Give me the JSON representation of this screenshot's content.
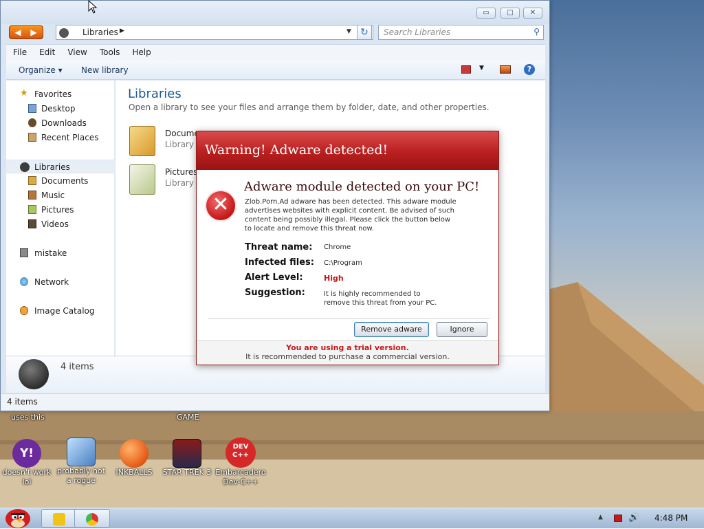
{
  "explorer": {
    "window_controls": {
      "minimize": "▭",
      "maximize": "□",
      "close": "✕"
    },
    "address": {
      "crumb": "Libraries"
    },
    "search": {
      "placeholder": "Search Libraries"
    },
    "menu": [
      "File",
      "Edit",
      "View",
      "Tools",
      "Help"
    ],
    "toolbar": {
      "organize": "Organize",
      "new_library": "New library"
    },
    "nav": {
      "favorites": "Favorites",
      "desktop": "Desktop",
      "downloads": "Downloads",
      "recent": "Recent Places",
      "libraries": "Libraries",
      "documents": "Documents",
      "music": "Music",
      "pictures": "Pictures",
      "videos": "Videos",
      "mistake": "mistake",
      "network": "Network",
      "image_catalog": "Image Catalog"
    },
    "content": {
      "heading": "Libraries",
      "description": "Open a library to see your files and arrange them by folder, date, and other properties.",
      "items": [
        {
          "name": "Docume",
          "type": "Library"
        },
        {
          "name": "Pictures",
          "type": "Library"
        }
      ]
    },
    "details": {
      "count": "4 items"
    },
    "status": "4 items"
  },
  "dialog": {
    "title": "Warning! Adware detected!",
    "headline": "Adware module detected on your PC!",
    "body": "Zlob.Porn.Ad adware has been detected. This adware module advertises websites with explicit content. Be advised of such content being possibly illegal. Please click the button below to locate and remove this threat now.",
    "fields": {
      "threat_label": "Threat name",
      "threat_value": "Chrome",
      "infected_label": "Infected files",
      "infected_value": "C:\\Program",
      "alert_label": "Alert Level",
      "alert_value": "High",
      "suggestion_label": "Suggestion",
      "suggestion_value": "It is highly recommended to remove this threat from your PC."
    },
    "colon": ":",
    "remove_button": "Remove adware",
    "ignore_button": "Ignore",
    "trial": "You are using a trial version.",
    "purchase": "It is recommended to purchase a commercial version."
  },
  "desktop": {
    "captions_top": {
      "left": "uses this",
      "mid": "GAME"
    },
    "icons": [
      {
        "label": "doesn't work lol",
        "color": "#6b2a9e"
      },
      {
        "label": "probably not a rogue",
        "color": "#4a7fc1"
      },
      {
        "label": "INKBALLS",
        "color": "#e8601a"
      },
      {
        "label": "STAR TREK 3",
        "color": "#2a2a4a"
      },
      {
        "label": "Embarcadero Dev-C++",
        "color": "#d62828"
      }
    ],
    "icon_text": {
      "yahoo": "Y!",
      "dev": "DEV C++"
    }
  },
  "taskbar": {
    "clock": "4:48 PM",
    "tray_up": "▲",
    "volume": "🔊",
    "apps": [
      {
        "name": "explorer",
        "color": "#f0c419"
      },
      {
        "name": "chrome",
        "color": "#3b7de0"
      }
    ]
  }
}
